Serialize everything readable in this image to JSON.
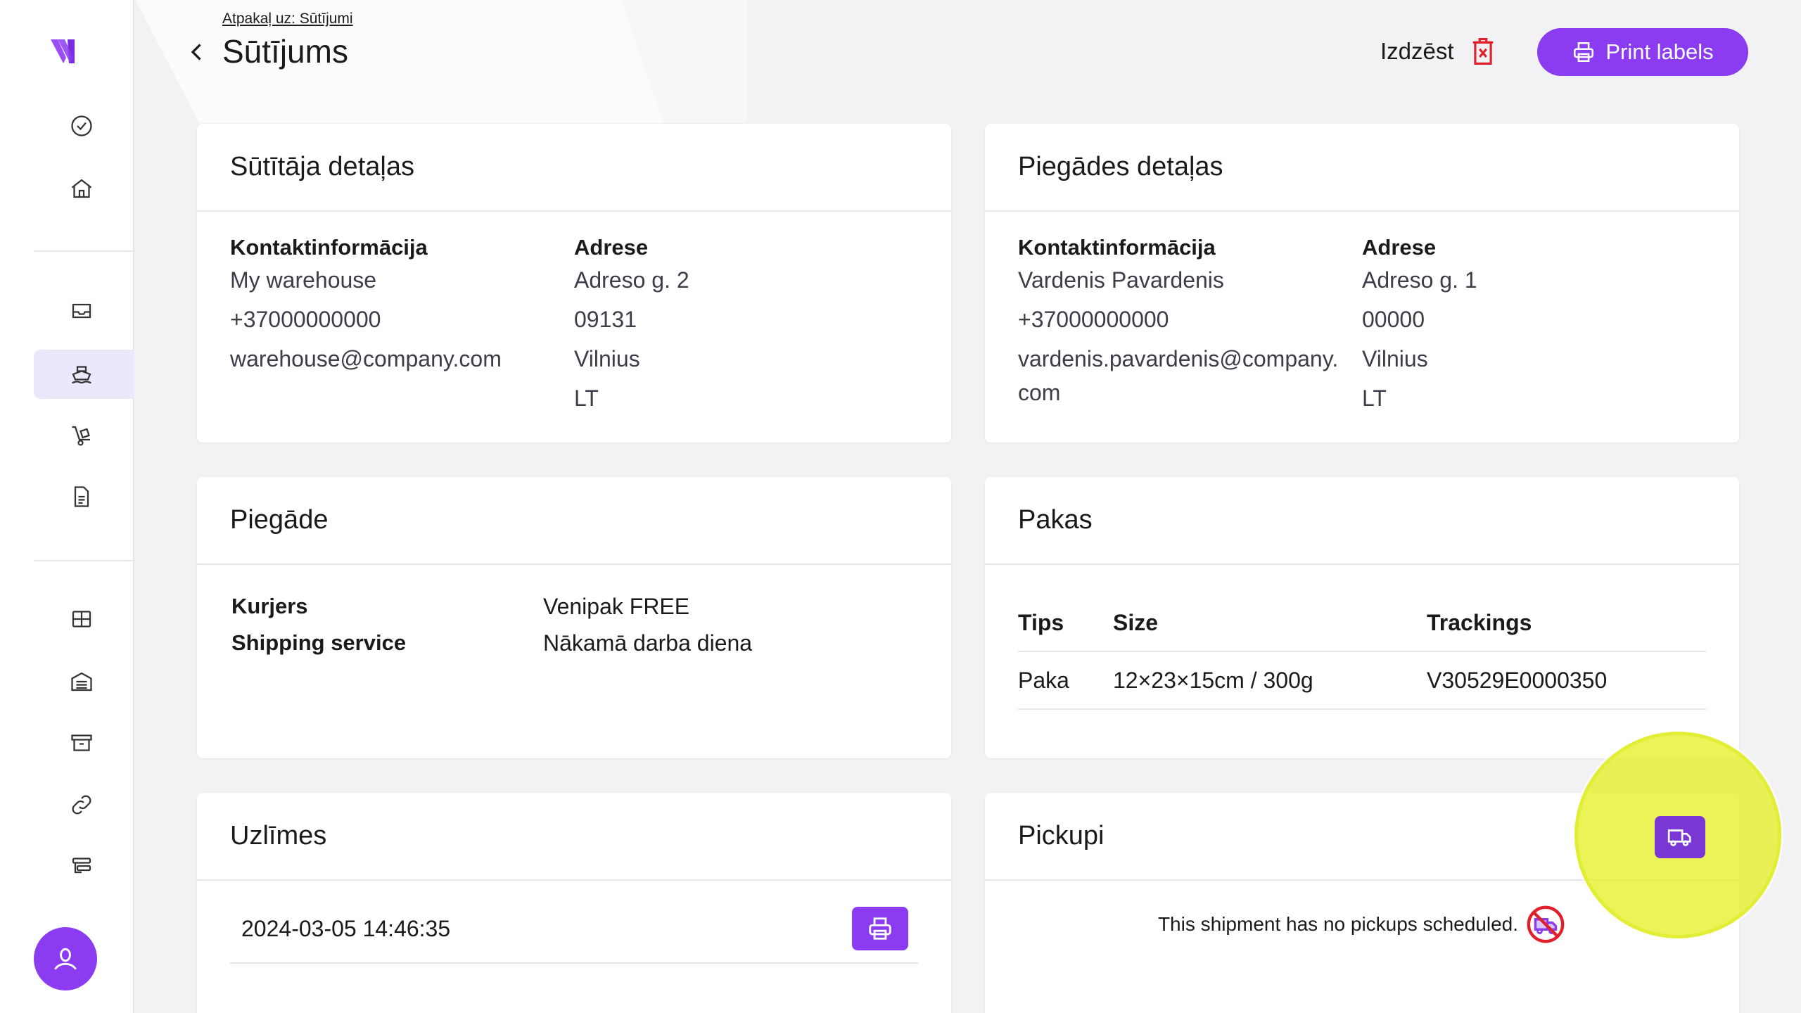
{
  "header": {
    "breadcrumb": "Atpakaļ uz: Sūtījumi",
    "title": "Sūtījums",
    "delete_label": "Izdzēst",
    "print_labels": "Print labels"
  },
  "sidebar": {
    "items": [
      {
        "name": "check-circle-icon"
      },
      {
        "name": "home-icon"
      },
      {
        "name": "inbox-icon"
      },
      {
        "name": "ship-icon",
        "active": true
      },
      {
        "name": "hand-truck-icon"
      },
      {
        "name": "document-icon"
      },
      {
        "name": "grid-icon"
      },
      {
        "name": "warehouse-icon"
      },
      {
        "name": "archive-icon"
      },
      {
        "name": "link-icon"
      },
      {
        "name": "integrations-icon"
      }
    ],
    "accent": "#8b3cf0"
  },
  "sender": {
    "title": "Sūtītāja detaļas",
    "contact_label": "Kontaktinformācija",
    "address_label": "Adrese",
    "name": "My warehouse",
    "phone": "+37000000000",
    "email": "warehouse@company.com",
    "street": "Adreso g. 2",
    "postcode": "09131",
    "city": "Vilnius",
    "country": "LT"
  },
  "delivery_details": {
    "title": "Piegādes detaļas",
    "contact_label": "Kontaktinformācija",
    "address_label": "Adrese",
    "name": "Vardenis Pavardenis",
    "phone": "+37000000000",
    "email_line1": "vardenis.pavardenis@company.",
    "email_line2": "com",
    "street": "Adreso g. 1",
    "postcode": "00000",
    "city": "Vilnius",
    "country": "LT"
  },
  "delivery": {
    "title": "Piegāde",
    "courier_label": "Kurjers",
    "courier_value": "Venipak FREE",
    "service_label": "Shipping service",
    "service_value": "Nākamā darba diena"
  },
  "packages": {
    "title": "Pakas",
    "columns": [
      "Tips",
      "Size",
      "Trackings"
    ],
    "rows": [
      {
        "type": "Paka",
        "size": "12×23×15cm / 300g",
        "tracking": "V30529E0000350"
      }
    ]
  },
  "labels": {
    "title": "Uzlīmes",
    "items": [
      {
        "date": "2024-03-05 14:46:35"
      }
    ]
  },
  "pickups": {
    "title": "Pickupi",
    "empty_text": "This shipment has no pickups scheduled."
  }
}
